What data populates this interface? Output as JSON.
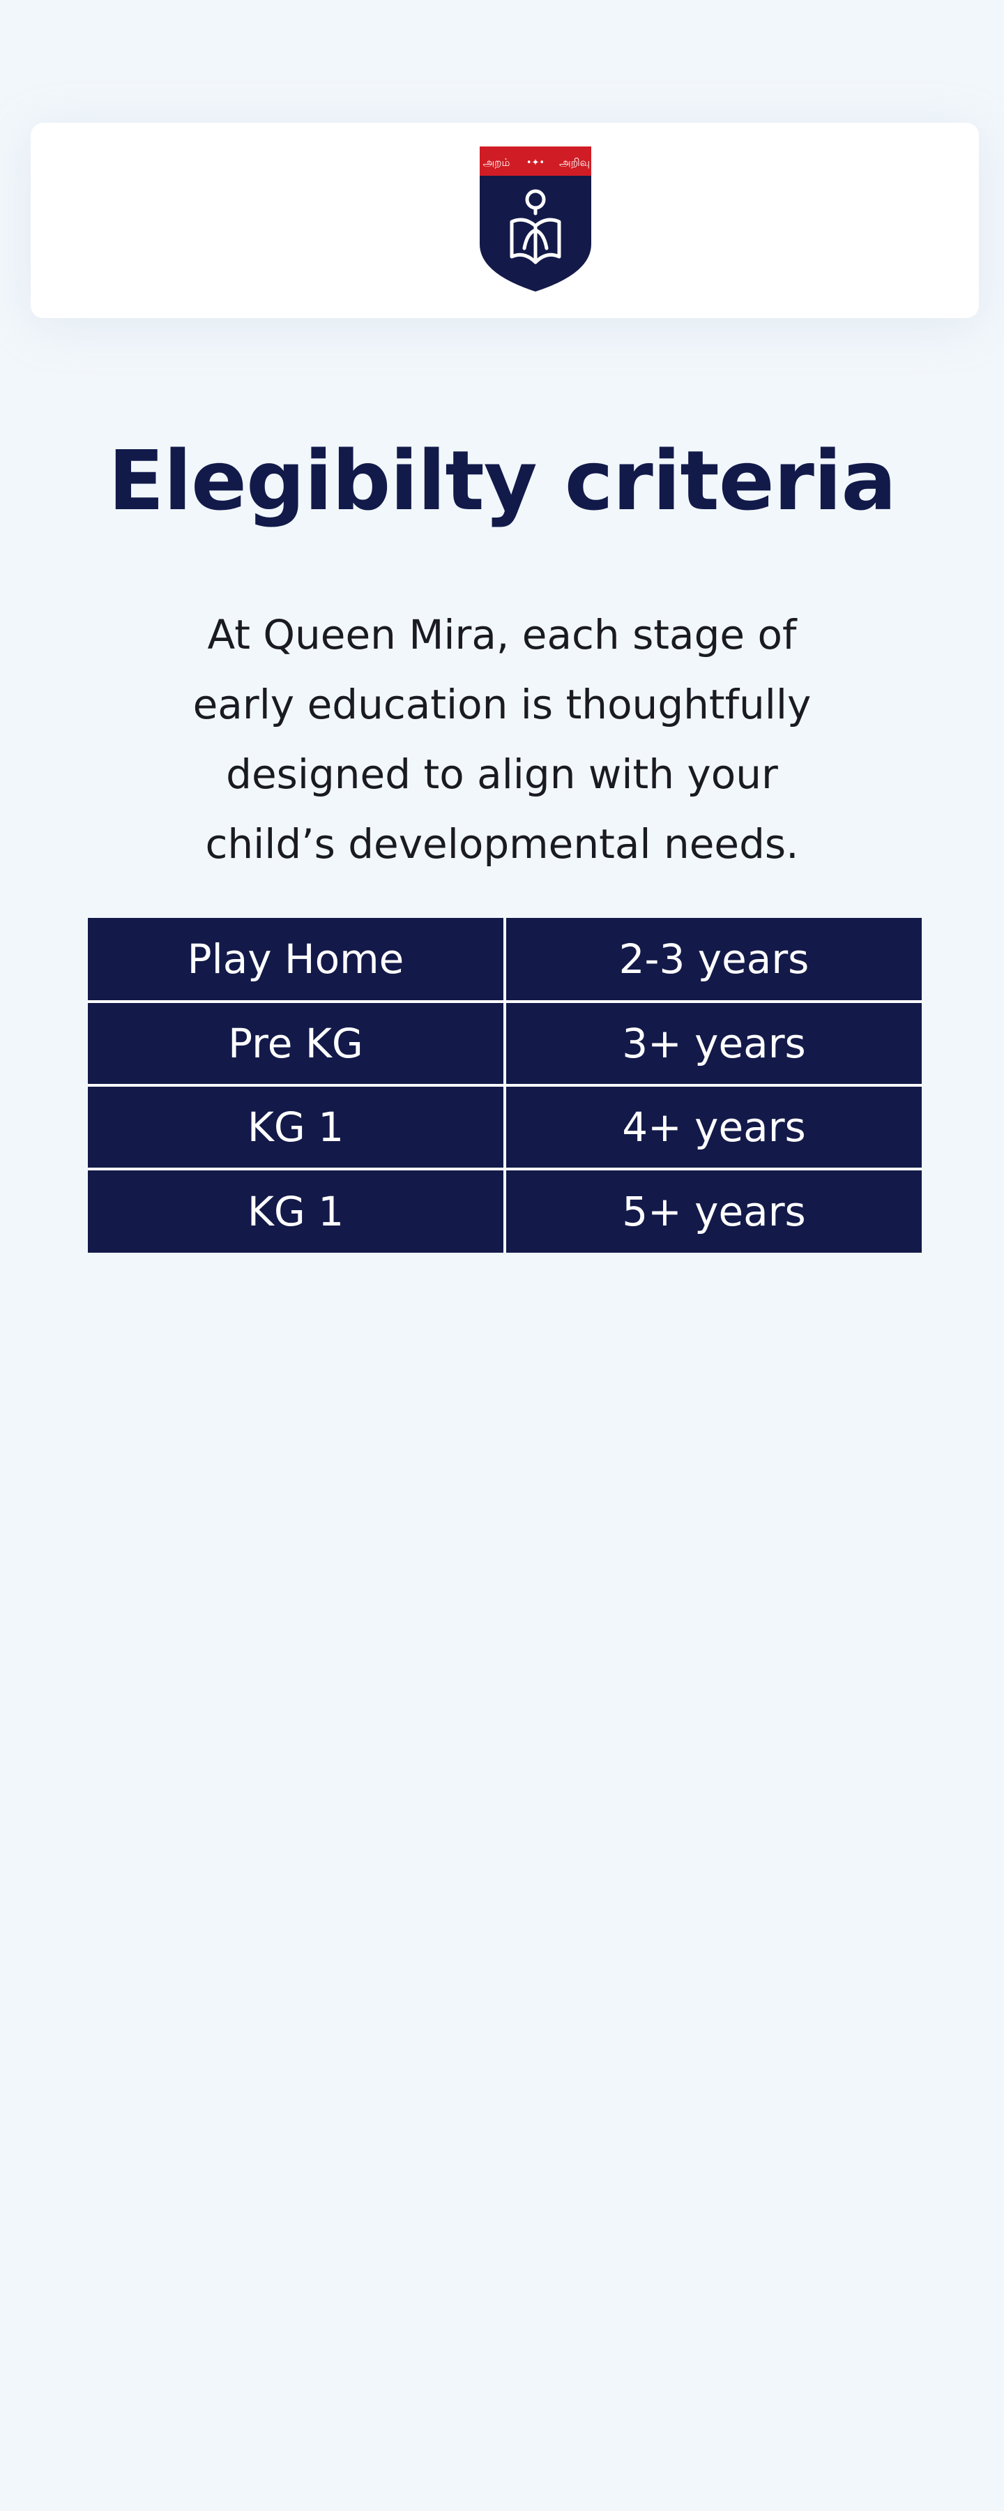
{
  "header": {
    "logo": {
      "icon": "school-crest-icon",
      "banner_text_left": "அறம்",
      "banner_text_mid": "•✦•",
      "banner_text_right": "அறிவு",
      "colors": {
        "banner": "#d01c24",
        "shield": "#131a49",
        "emblem": "#ffffff"
      }
    }
  },
  "main": {
    "title": "Elegibilty criteria",
    "intro_lines": [
      "At Queen Mira, each stage of",
      "early education is thoughtfully",
      "designed to align with your",
      "child’s developmental needs."
    ],
    "table": {
      "rows": [
        {
          "class": "Play Home",
          "age": "2-3 years"
        },
        {
          "class": "Pre KG",
          "age": "3+ years"
        },
        {
          "class": "KG 1",
          "age": "4+ years"
        },
        {
          "class": "KG 1",
          "age": "5+ years"
        }
      ]
    }
  },
  "colors": {
    "page_background": "#f2f7fb",
    "title": "#121a4a",
    "table_background": "#131a49",
    "table_text": "#ffffff"
  }
}
